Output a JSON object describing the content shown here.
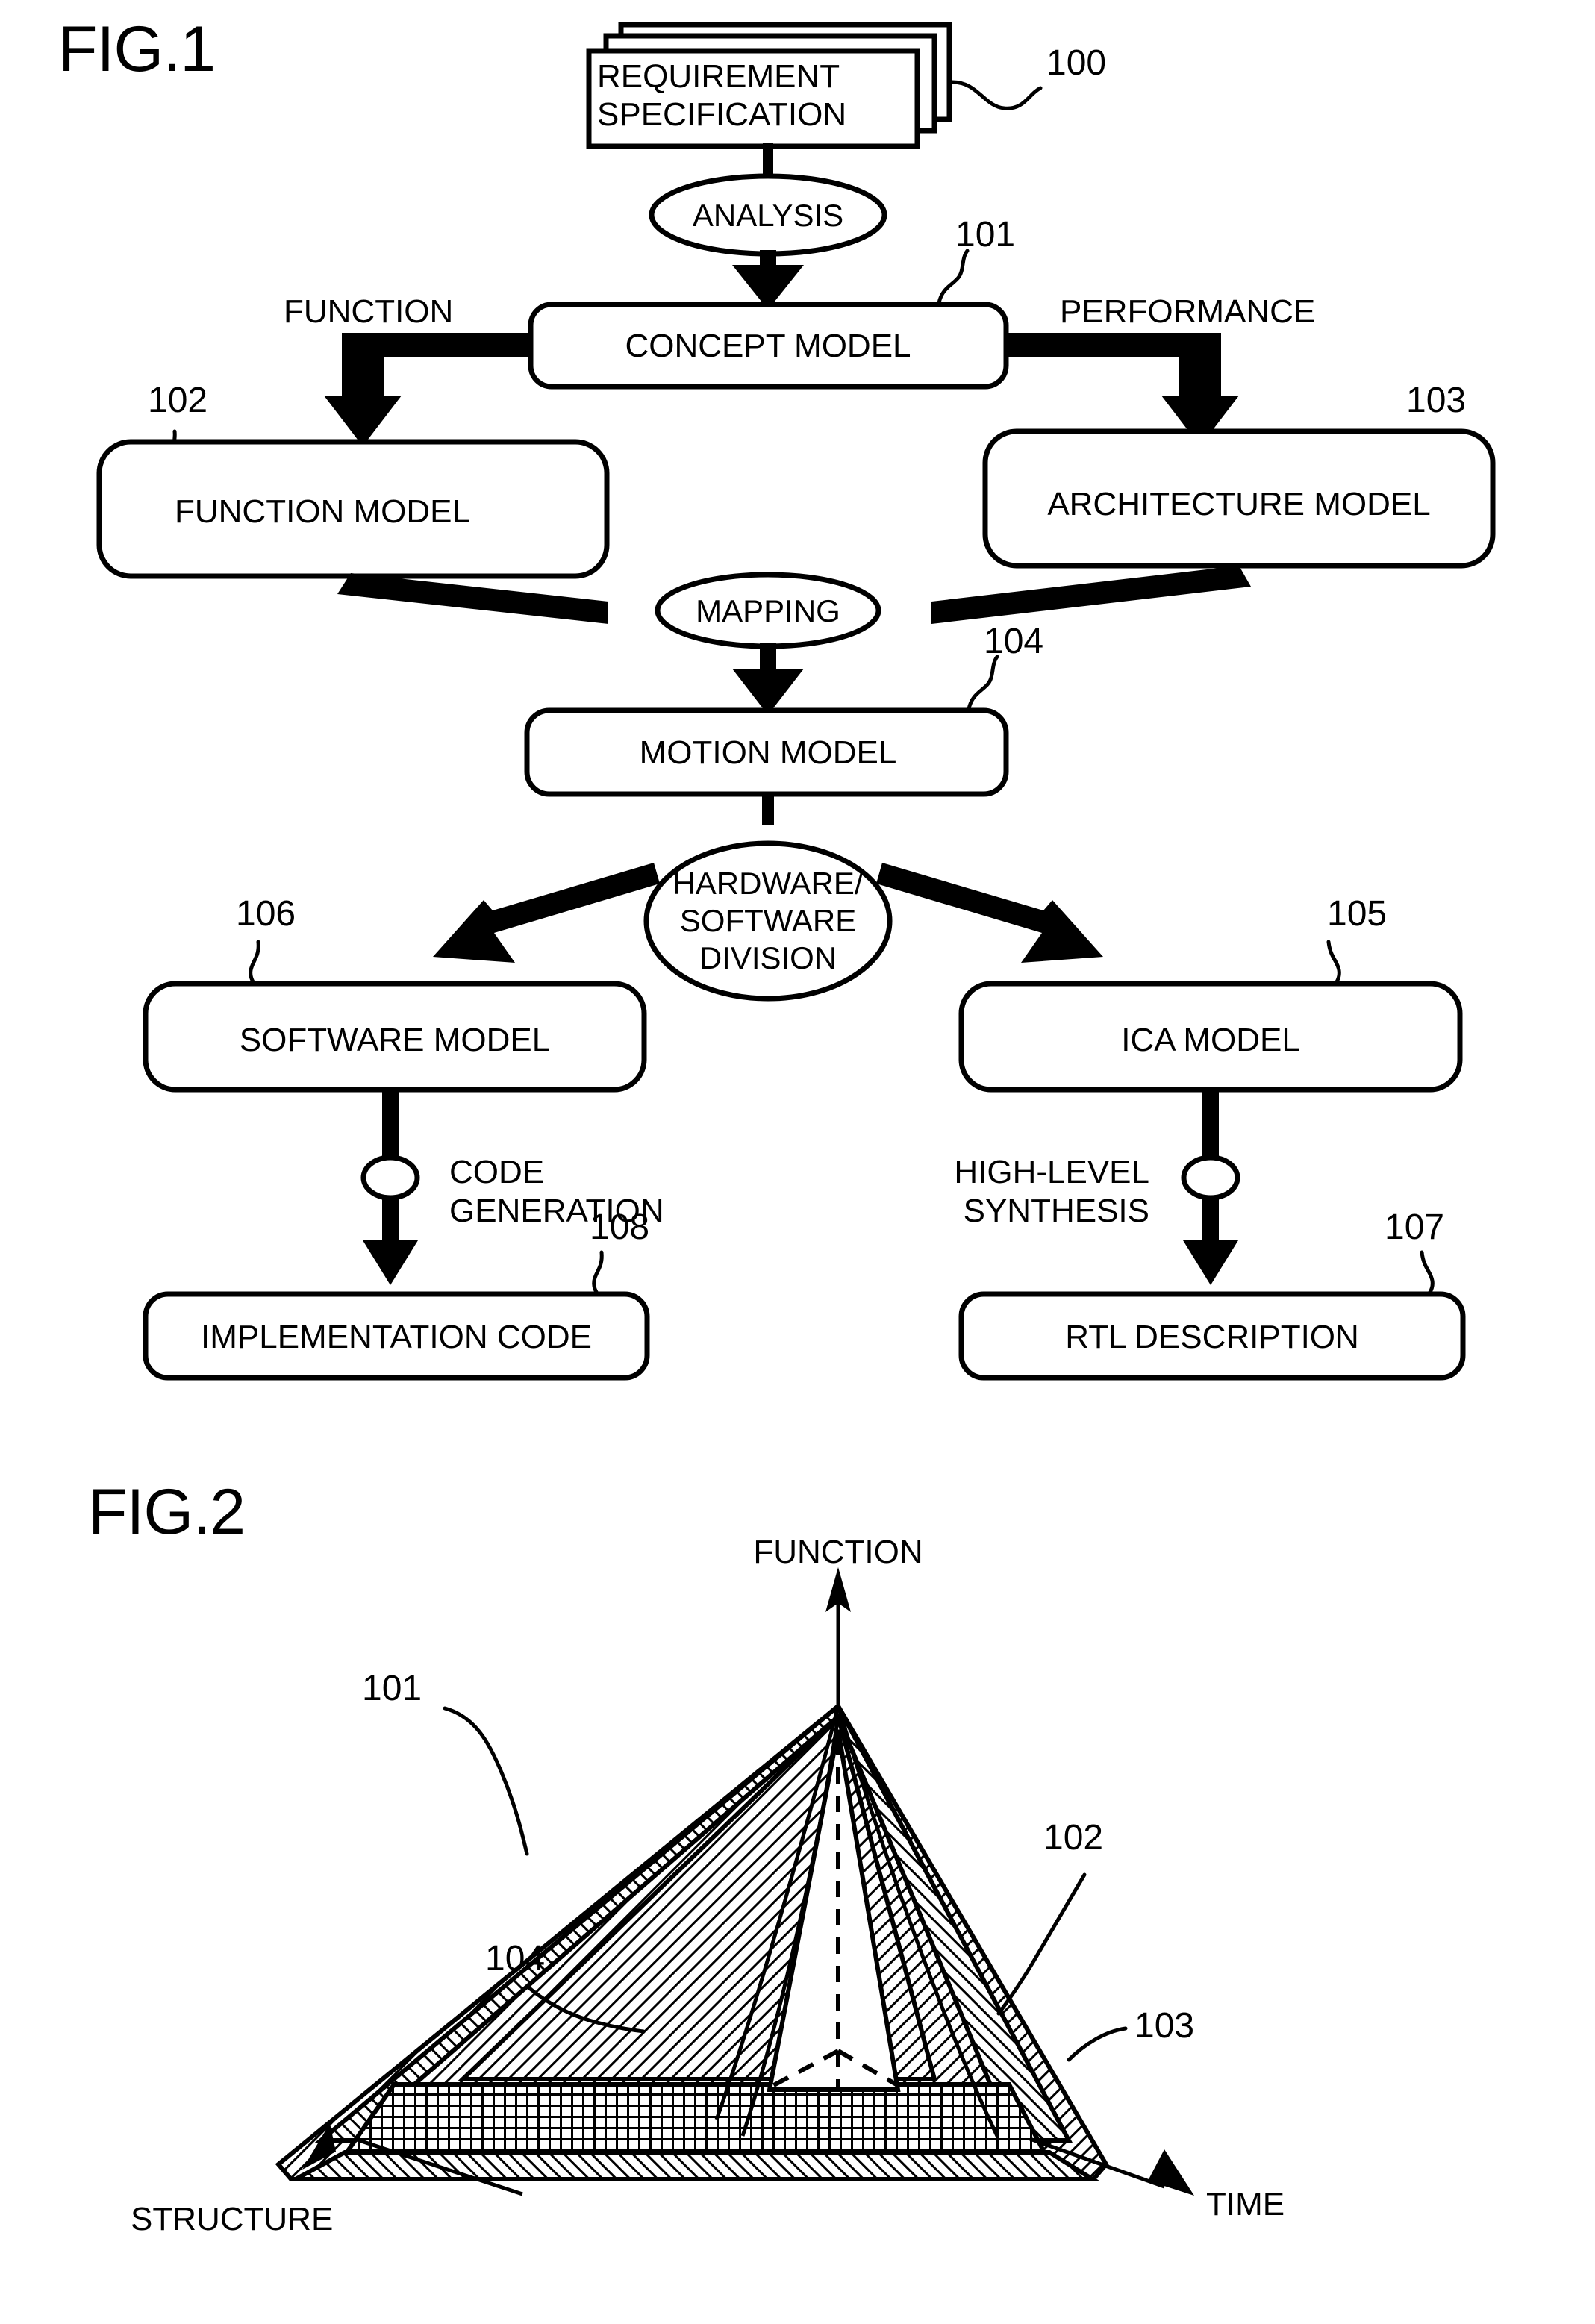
{
  "figures": [
    {
      "id": "fig1",
      "label": "FIG.1",
      "nodes": {
        "requirement_specification": "REQUIREMENT\nSPECIFICATION",
        "requirement_specification_line1": "REQUIREMENT",
        "requirement_specification_line2": "SPECIFICATION",
        "analysis": "ANALYSIS",
        "concept_model": "CONCEPT MODEL",
        "function_model": "FUNCTION MODEL",
        "architecture_model": "ARCHITECTURE MODEL",
        "mapping": "MAPPING",
        "motion_model": "MOTION MODEL",
        "hw_sw_division_line1": "HARDWARE/",
        "hw_sw_division_line2": "SOFTWARE",
        "hw_sw_division_line3": "DIVISION",
        "software_model": "SOFTWARE MODEL",
        "ica_model": "ICA MODEL",
        "implementation_code": "IMPLEMENTATION CODE",
        "rtl_description": "RTL DESCRIPTION"
      },
      "edge_labels": {
        "function": "FUNCTION",
        "performance": "PERFORMANCE",
        "code_generation_line1": "CODE",
        "code_generation_line2": "GENERATION",
        "high_level_synthesis_line1": "HIGH-LEVEL",
        "high_level_synthesis_line2": "SYNTHESIS"
      },
      "reference_numerals": {
        "requirement_specification": "100",
        "concept_model": "101",
        "function_model": "102",
        "architecture_model": "103",
        "motion_model": "104",
        "ica_model": "105",
        "software_model": "106",
        "rtl_description": "107",
        "implementation_code": "108"
      }
    },
    {
      "id": "fig2",
      "label": "FIG.2",
      "axes": {
        "function": "FUNCTION",
        "structure": "STRUCTURE",
        "time": "TIME"
      },
      "reference_numerals": {
        "layer1": "101",
        "layer2": "102",
        "layer3": "103",
        "layer4": "104"
      }
    }
  ],
  "colors": {
    "ink": "#000000",
    "paper": "#ffffff"
  }
}
